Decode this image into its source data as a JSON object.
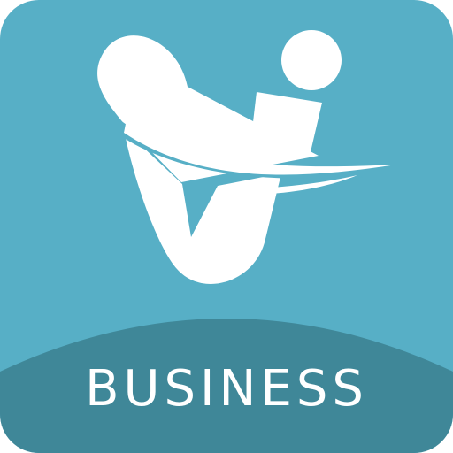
{
  "app_icon": {
    "label": "BUSINESS",
    "logo_icon": "vi-swoosh-logo-icon",
    "colors": {
      "background": "#57AFC6",
      "band": "#3F8798",
      "logo": "#FFFFFF",
      "label_text": "#FFFFFF"
    }
  }
}
